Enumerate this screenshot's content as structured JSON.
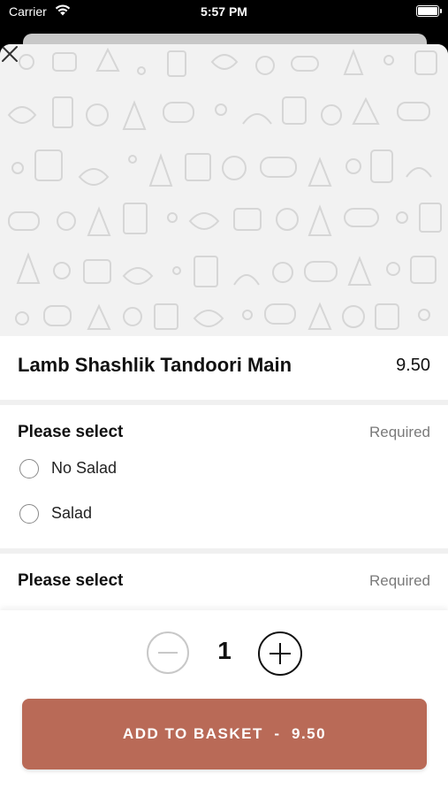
{
  "status_bar": {
    "carrier": "Carrier",
    "time": "5:57 PM"
  },
  "item": {
    "name": "Lamb Shashlik Tandoori Main",
    "price": "9.50"
  },
  "groups": [
    {
      "title": "Please select",
      "requirement": "Required",
      "options": [
        "No Salad",
        "Salad"
      ]
    },
    {
      "title": "Please select",
      "requirement": "Required",
      "options": []
    }
  ],
  "quantity": "1",
  "add_button": {
    "label": "ADD TO BASKET",
    "separator": "-",
    "price": "9.50"
  },
  "colors": {
    "accent": "#b96a57",
    "hero_bg": "#f2f2f2"
  },
  "icons": {
    "close": "close-icon",
    "minus": "minus-icon",
    "plus": "plus-icon",
    "wifi": "wifi-icon",
    "battery": "battery-icon"
  }
}
